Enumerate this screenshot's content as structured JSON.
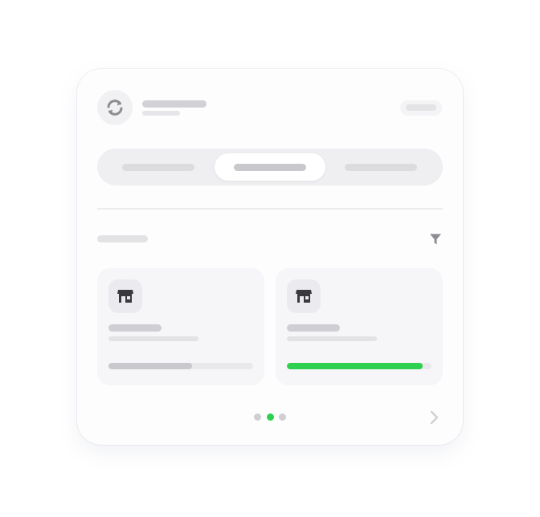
{
  "colors": {
    "accent_green": "#2ed04f",
    "neutral_fill": "#c9c9cd",
    "dot_inactive": "#cfcfd3",
    "icon_gray": "#8d8d92",
    "icon_dark": "#3a3a3e"
  },
  "header": {
    "logo_icon": "sync-icon"
  },
  "segmented": {
    "active_index": 1,
    "tab_count": 3
  },
  "section": {
    "filter_icon": "filter-icon"
  },
  "listings": [
    {
      "icon": "storefront-icon",
      "progress": 0.58
    },
    {
      "icon": "storefront-icon",
      "progress": 0.94
    }
  ],
  "pagination": {
    "pages": 3,
    "current": 2,
    "next_icon": "chevron-right-icon"
  }
}
